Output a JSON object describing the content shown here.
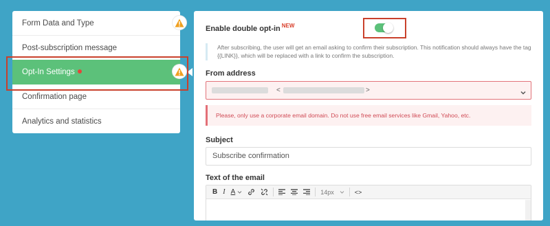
{
  "sidebar": {
    "items": [
      {
        "label": "Form Data and Type"
      },
      {
        "label": "Post-subscription message"
      },
      {
        "label": "Opt-In Settings"
      },
      {
        "label": "Confirmation page"
      },
      {
        "label": "Analytics and statistics"
      }
    ],
    "active_index": 2
  },
  "optin": {
    "title": "Enable double opt-in",
    "new_tag": "NEW",
    "enabled": true,
    "note": "After subscribing, the user will get an email asking to confirm their subscription. This notification should always have the tag {{LINK}}, which will be replaced with a link to confirm the subscription."
  },
  "from": {
    "label": "From address",
    "open_bracket": "<",
    "close_bracket": ">",
    "error": "Please, only use a corporate email domain. Do not use free email services like Gmail, Yahoo, etc."
  },
  "subject": {
    "label": "Subject",
    "value": "Subscribe confirmation"
  },
  "email_text": {
    "label": "Text of the email",
    "toolbar": {
      "bold": "B",
      "italic": "I",
      "font_color": "A",
      "font_size": "14px",
      "code": "<>"
    }
  },
  "colors": {
    "background": "#3fa4c6",
    "active_green": "#5cc17a",
    "error_red": "#d04a55",
    "highlight": "#c9402b",
    "warning": "#f0a020"
  },
  "icons": {
    "warning": "warning-triangle-icon",
    "chevron": "chevron-down-icon",
    "link": "link-icon",
    "unlink": "unlink-icon"
  }
}
